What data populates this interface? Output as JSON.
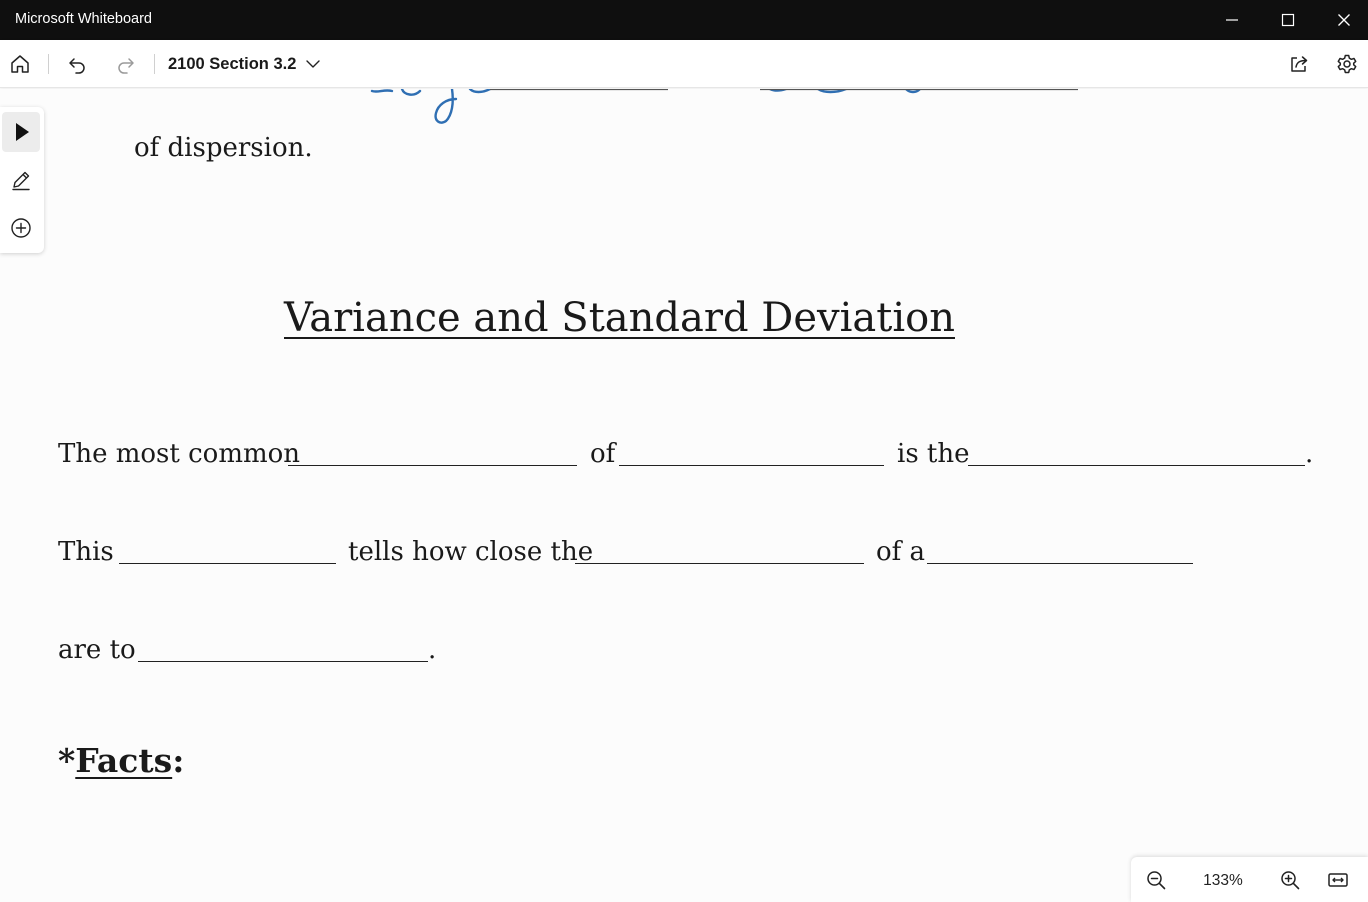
{
  "window": {
    "title": "Microsoft Whiteboard"
  },
  "toolbar": {
    "board_name": "2100 Section 3.2"
  },
  "board": {
    "partial_line": "of dispersion.",
    "heading": "Variance and Standard Deviation",
    "line1": {
      "a": "The most common",
      "b": "of",
      "c": "is the",
      "end": "."
    },
    "line2": {
      "a": "This",
      "b": "tells how close the",
      "c": "of a"
    },
    "line3": {
      "a": "are to",
      "end": "."
    },
    "facts": {
      "star": "*",
      "label": "Facts",
      "colon": ":"
    }
  },
  "ink": {
    "color": "#2f6fb3"
  },
  "zoom": {
    "level": "133%"
  },
  "icons": {
    "home": "home-icon",
    "undo": "undo-icon",
    "redo": "redo-icon",
    "share": "share-icon",
    "settings": "gear-icon",
    "select": "pointer-icon",
    "pen": "pen-icon",
    "add": "plus-circle-icon",
    "zoom_out": "zoom-out-icon",
    "zoom_in": "zoom-in-icon",
    "fit": "fit-width-icon"
  }
}
